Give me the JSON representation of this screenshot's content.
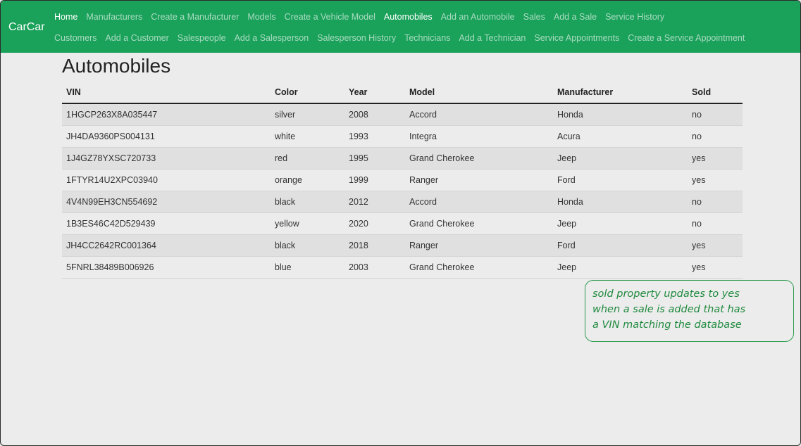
{
  "brand": "CarCar",
  "nav": {
    "row1": [
      {
        "label": "Home",
        "active": true
      },
      {
        "label": "Manufacturers",
        "active": false
      },
      {
        "label": "Create a Manufacturer",
        "active": false
      },
      {
        "label": "Models",
        "active": false
      },
      {
        "label": "Create a Vehicle Model",
        "active": false
      },
      {
        "label": "Automobiles",
        "active": true
      },
      {
        "label": "Add an Automobile",
        "active": false
      },
      {
        "label": "Sales",
        "active": false
      },
      {
        "label": "Add a Sale",
        "active": false
      },
      {
        "label": "Service History",
        "active": false
      }
    ],
    "row2": [
      {
        "label": "Customers",
        "active": false
      },
      {
        "label": "Add a Customer",
        "active": false
      },
      {
        "label": "Salespeople",
        "active": false
      },
      {
        "label": "Add a Salesperson",
        "active": false
      },
      {
        "label": "Salesperson History",
        "active": false
      },
      {
        "label": "Technicians",
        "active": false
      },
      {
        "label": "Add a Technician",
        "active": false
      },
      {
        "label": "Service Appointments",
        "active": false
      },
      {
        "label": "Create a Service Appointment",
        "active": false
      }
    ]
  },
  "page_title": "Automobiles",
  "table": {
    "headers": [
      "VIN",
      "Color",
      "Year",
      "Model",
      "Manufacturer",
      "Sold"
    ],
    "rows": [
      [
        "1HGCP263X8A035447",
        "silver",
        "2008",
        "Accord",
        "Honda",
        "no"
      ],
      [
        "JH4DA9360PS004131",
        "white",
        "1993",
        "Integra",
        "Acura",
        "no"
      ],
      [
        "1J4GZ78YXSC720733",
        "red",
        "1995",
        "Grand Cherokee",
        "Jeep",
        "yes"
      ],
      [
        "1FTYR14U2XPC03940",
        "orange",
        "1999",
        "Ranger",
        "Ford",
        "yes"
      ],
      [
        "4V4N99EH3CN554692",
        "black",
        "2012",
        "Accord",
        "Honda",
        "no"
      ],
      [
        "1B3ES46C42D529439",
        "yellow",
        "2020",
        "Grand Cherokee",
        "Jeep",
        "no"
      ],
      [
        "JH4CC2642RC001364",
        "black",
        "2018",
        "Ranger",
        "Ford",
        "yes"
      ],
      [
        "5FNRL38489B006926",
        "blue",
        "2003",
        "Grand Cherokee",
        "Jeep",
        "yes"
      ]
    ]
  },
  "annotation": {
    "lines": [
      "sold property updates to yes",
      "when a sale is added that has",
      "a VIN matching the database"
    ]
  },
  "colors": {
    "navbar": "#1aa15a",
    "annotation": "#1f8a3e"
  }
}
